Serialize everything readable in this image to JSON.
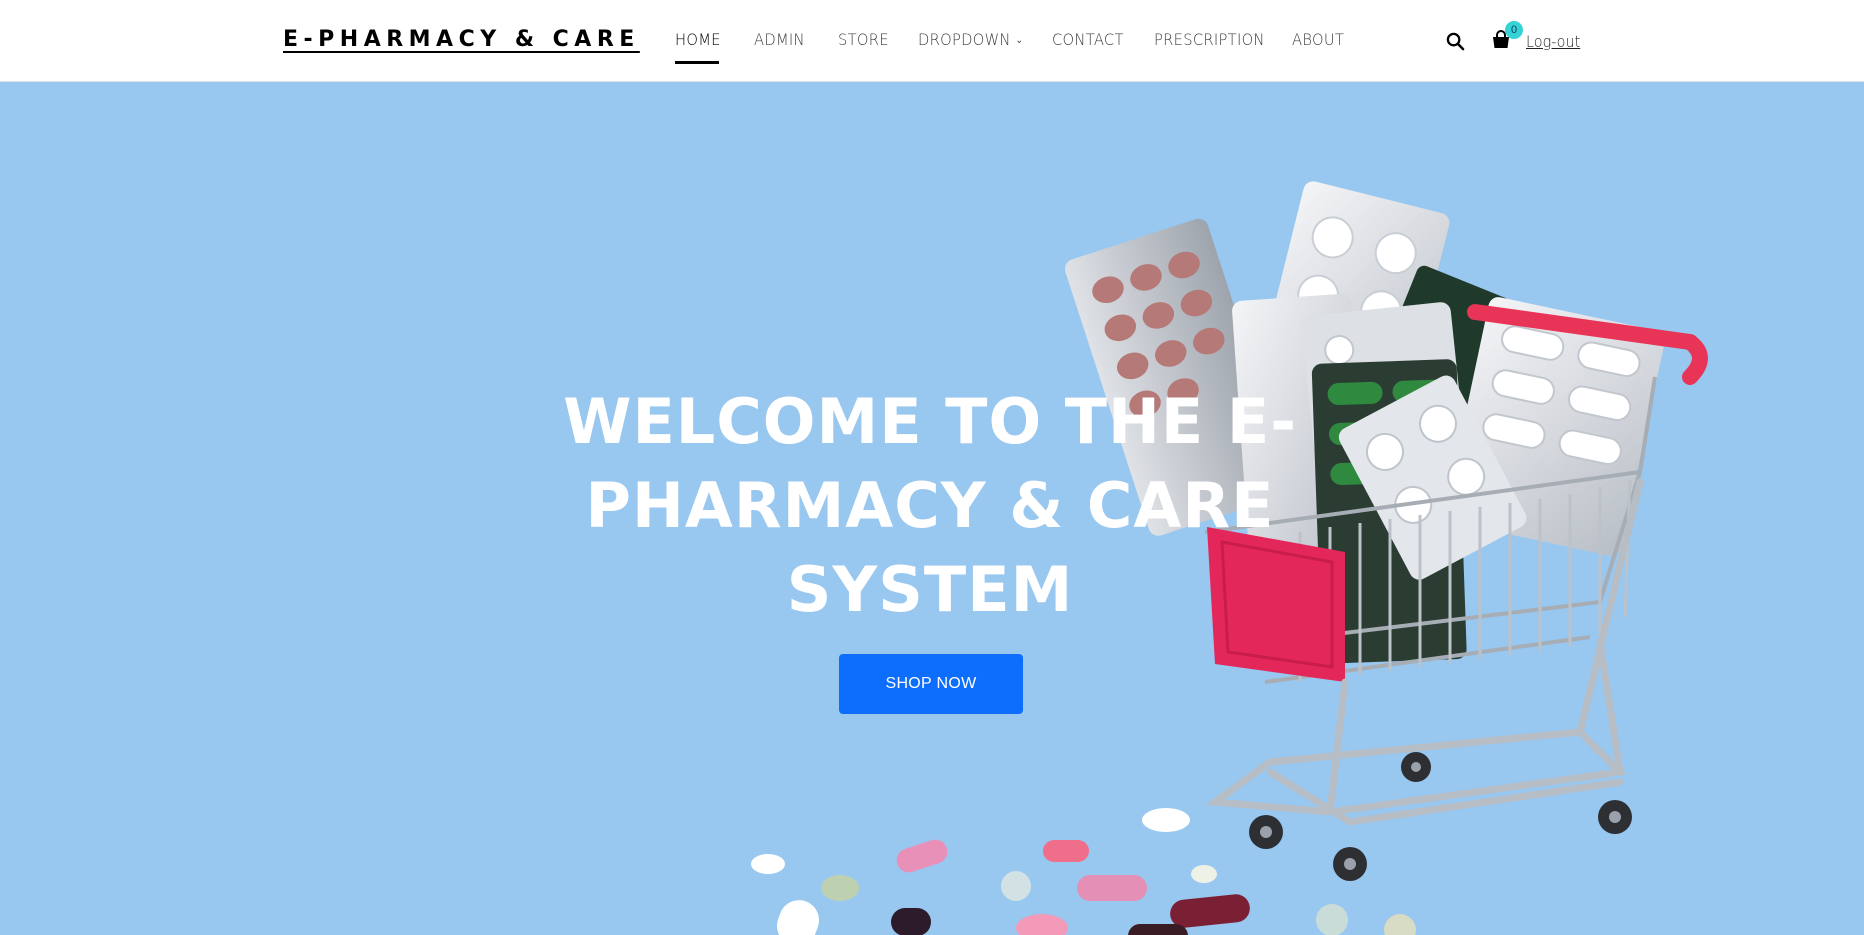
{
  "brand": {
    "logo_text": "E-PHARMACY & CARE"
  },
  "nav": {
    "items": [
      {
        "label": "HOME",
        "active": true
      },
      {
        "label": "ADMIN"
      },
      {
        "label": "STORE"
      },
      {
        "label": "DROPDOWN",
        "has_dropdown": true
      },
      {
        "label": "CONTACT"
      },
      {
        "label": "PRESCRIPTION"
      },
      {
        "label": "ABOUT"
      }
    ]
  },
  "header_actions": {
    "search_icon": "search-icon",
    "cart_icon": "shopping-bag-icon",
    "cart_count": "0",
    "logout_label": "Log-out"
  },
  "hero": {
    "title": "WELCOME TO THE E-PHARMACY & CARE SYSTEM",
    "button_label": "SHOP NOW",
    "background_color": "#98c7f0",
    "button_color": "#0d6efd",
    "image": "shopping-cart-with-pill-blister-packs"
  }
}
